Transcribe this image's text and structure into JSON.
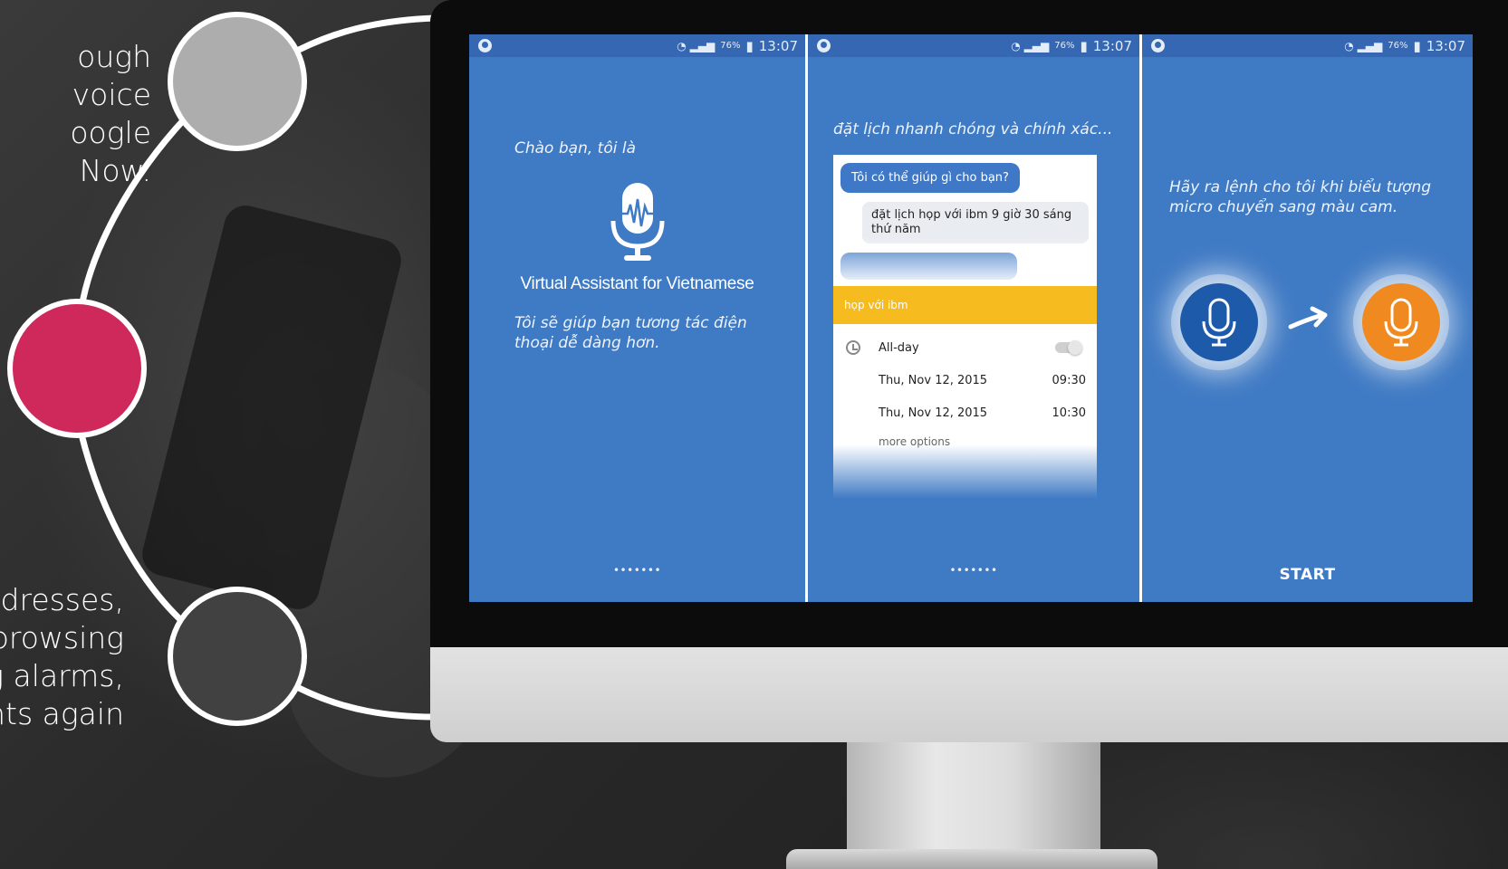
{
  "left_text": {
    "top_lines": [
      "ough voice",
      "oogle Now."
    ],
    "bottom_lines": [
      "ddresses,",
      "browsing",
      "g alarms,",
      "nts again"
    ]
  },
  "colors": {
    "node_top": "#adadad",
    "node_mid": "#cf285b",
    "node_bot": "#414141",
    "screen_blue": "#3f7ac4",
    "event_yellow": "#f5bb1f",
    "mic_orange": "#f0891f"
  },
  "status_bar": {
    "battery": "76%",
    "time": "13:07"
  },
  "panel1": {
    "greeting": "Chào bạn, tôi là",
    "app_name": "Virtual Assistant for Vietnamese",
    "tagline": "Tôi sẽ giúp bạn tương tác điện thoại dễ dàng hơn.",
    "dots": "•••••••"
  },
  "panel2": {
    "heading": "đặt lịch nhanh chóng và chính xác...",
    "bubble_question": "Tôi có thể giúp gì cho bạn?",
    "bubble_answer": "đặt lịch họp với ibm 9 giờ 30 sáng thứ năm",
    "event_title": "họp với ibm",
    "all_day_label": "All-day",
    "start_date": "Thu, Nov 12, 2015",
    "start_time": "09:30",
    "end_date": "Thu, Nov 12, 2015",
    "end_time": "10:30",
    "more_options": "more options",
    "dots": "•••••••"
  },
  "panel3": {
    "instruction": "Hãy ra lệnh cho tôi khi biểu tượng micro chuyển sang màu cam.",
    "start_label": "START"
  }
}
